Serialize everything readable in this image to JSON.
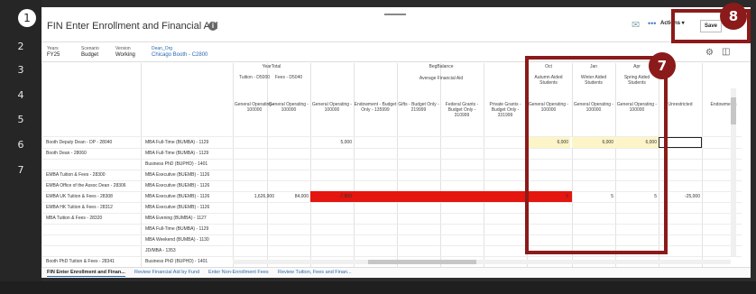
{
  "gutter": {
    "rows": [
      "1",
      "2",
      "3",
      "4",
      "5",
      "6",
      "7"
    ]
  },
  "toolbar": {
    "title": "FIN Enter Enrollment and Financial Aid",
    "actions_label": "Actions ▾",
    "save_label": "Save",
    "more_label": "•••"
  },
  "pov": [
    {
      "label": "Years",
      "value": "FY25"
    },
    {
      "label": "Scenario",
      "value": "Budget"
    },
    {
      "label": "Version",
      "value": "Working"
    },
    {
      "label": "Dean_Org",
      "value": "Chicago Booth - C2800"
    }
  ],
  "header": {
    "year_total": "YearTotal",
    "beg_balance": "BegBalance",
    "avg_fin_aid": "Average Financial Aid",
    "months": [
      "Oct",
      "Jan",
      "Apr"
    ],
    "aided": [
      "Autumn Aided Students",
      "Winter Aided Students",
      "Spring Aided Students"
    ],
    "yt_cols": [
      "Tuition - D5000",
      "Fees - D5040"
    ],
    "funds": [
      "General Operating - 100000",
      "General Operating - 100000",
      "General Operating - 100000",
      "Endowment - Budget Only - 135999",
      "Gifts - Budget Only - 219999",
      "Federal Grants - Budget Only - 310999",
      "Private Grants - Budget Only - 331999",
      "General Operating - 100000",
      "General Operating - 100000",
      "General Operating - 100000",
      "Unrestricted",
      "Endowments"
    ]
  },
  "rows": [
    {
      "dept": "Booth Deputy Dean - DP - 28040",
      "program": "MBA Full-Time (BUMBA) - 1129",
      "values": [
        "",
        "",
        "5,000",
        "",
        "",
        "",
        "",
        "6,000",
        "6,000",
        "6,000",
        "",
        ""
      ]
    },
    {
      "dept": "Booth Dean - 28060",
      "program": "MBA Full-Time (BUMBA) - 1129",
      "values": []
    },
    {
      "dept": "",
      "program": "Business PhD (BUPHD) - 1401",
      "values": []
    },
    {
      "dept": "EMBA Tuition & Fees - 28300",
      "program": "MBA Executive (BUEMB) - 1126",
      "values": []
    },
    {
      "dept": "EMBA Office of the Assoc Dean - 28306",
      "program": "MBA Executive (BUEMB) - 1126",
      "values": []
    },
    {
      "dept": "EMBA UK Tuition & Fees - 28308",
      "program": "MBA Executive (BUEMB) - 1126",
      "values": [
        "1,626,900",
        "84,000",
        "-7,800",
        "",
        "",
        "",
        "",
        "5",
        "5",
        "5",
        "-25,000",
        ""
      ]
    },
    {
      "dept": "EMBA HK Tuition & Fees - 28312",
      "program": "MBA Executive (BUEMB) - 1126",
      "values": []
    },
    {
      "dept": "MBA Tuition & Fees - 28320",
      "program": "MBA Evening (BUMBA) - 1127",
      "values": []
    },
    {
      "dept": "",
      "program": "MBA Full-Time (BUMBA) - 1129",
      "values": []
    },
    {
      "dept": "",
      "program": "MBA Weekend (BUMBA) - 1130",
      "values": []
    },
    {
      "dept": "",
      "program": "JD/MBA - 1353",
      "values": []
    },
    {
      "dept": "Booth PhD Tuition & Fees - 28341",
      "program": "Business PhD (BUPHD) - 1401",
      "values": []
    }
  ],
  "tabs": [
    "FIN Enter Enrollment and Finan...",
    "Review Financial Aid by Fund",
    "Enter Non-Enrollment Fees",
    "Review Tuition, Fees and Finan..."
  ],
  "callouts": {
    "badge7": "7",
    "badge8": "8"
  },
  "colors": {
    "callout": "#8b1a1a",
    "highlight_yellow": "#fdf5c8",
    "error_red": "#e5150f"
  }
}
